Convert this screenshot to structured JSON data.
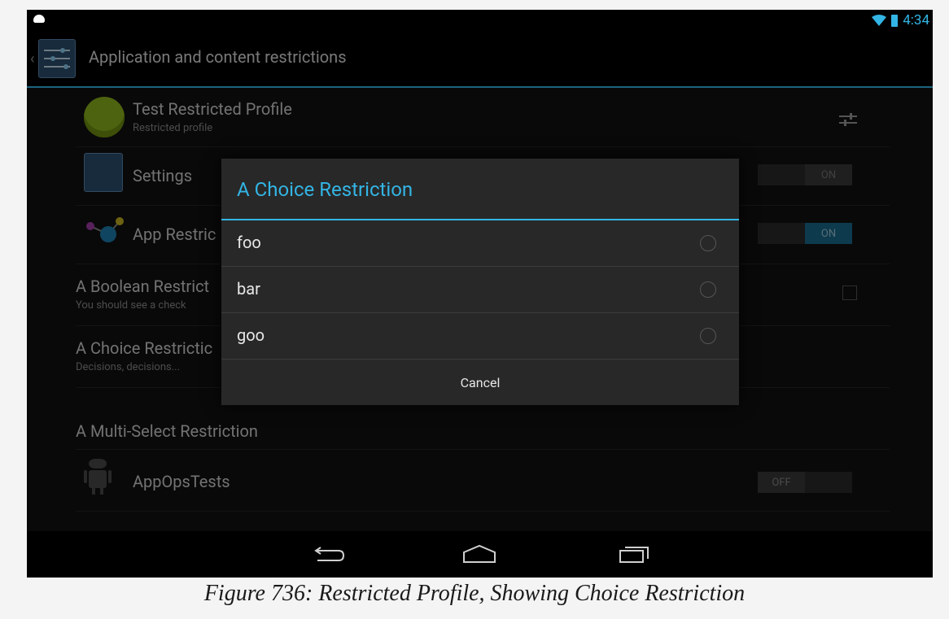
{
  "status": {
    "time": "4:34"
  },
  "actionbar": {
    "title": "Application and content restrictions"
  },
  "rows": {
    "profile": {
      "name": "Test Restricted Profile",
      "subtitle": "Restricted profile"
    },
    "settings": {
      "label": "Settings",
      "toggle": "ON"
    },
    "app_restrictions": {
      "label": "App Restric",
      "toggle": "ON"
    },
    "boolean": {
      "label": "A Boolean Restrict",
      "subtitle": "You should see a check"
    },
    "choice": {
      "label": "A Choice Restrictic",
      "subtitle": "Decisions, decisions..."
    },
    "multi": {
      "label": "A Multi-Select Restriction"
    },
    "appops": {
      "label": "AppOpsTests",
      "toggle": "OFF"
    }
  },
  "dialog": {
    "title": "A Choice Restriction",
    "options": [
      "foo",
      "bar",
      "goo"
    ],
    "cancel": "Cancel"
  },
  "caption": "Figure 736: Restricted Profile, Showing Choice Restriction",
  "colors": {
    "accent": "#33b5e5",
    "background": "#121212",
    "dialog": "#282828"
  }
}
